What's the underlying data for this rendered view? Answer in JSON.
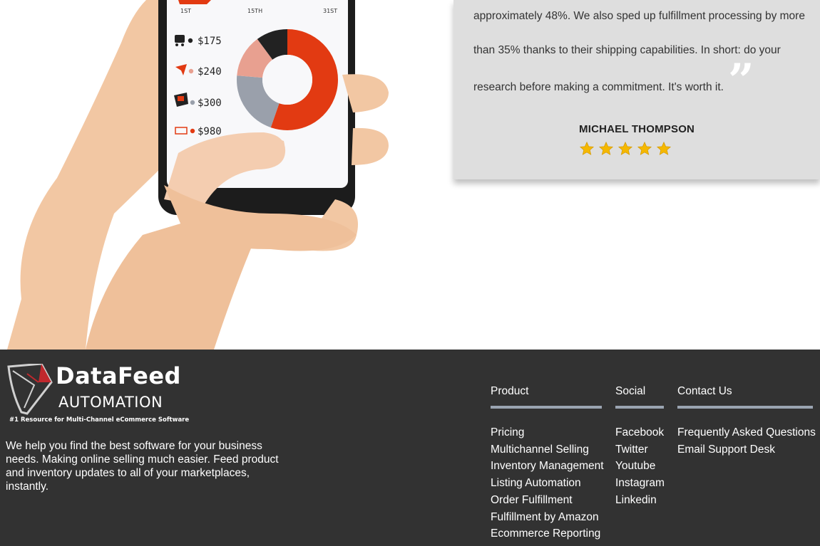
{
  "testimonial": {
    "lines": [
      "approximately 48%. We also sped up fulfillment processing by more",
      "than 35% thanks to their shipping capabilities. In short: do your",
      "research before making a commitment. It's worth it."
    ],
    "quote_mark": "”",
    "author": "MICHAEL THOMPSON",
    "rating": 5
  },
  "phone": {
    "axis_labels": [
      "1ST",
      "15TH",
      "31ST"
    ],
    "amounts": [
      "$175",
      "$240",
      "$300",
      "$980"
    ],
    "icons": [
      "cart-icon",
      "plane-icon",
      "box-icon",
      "cash-icon"
    ],
    "dot_colors": [
      "#222222",
      "#e8a090",
      "#9aa0ab",
      "#e23a12"
    ],
    "donut_colors": [
      "#e23a12",
      "#9aa0ab",
      "#e8a090",
      "#222222"
    ]
  },
  "footer": {
    "logo": {
      "word1": "DataFeed",
      "word2": "AUTOMATION",
      "tagline": "#1 Resource for Multi-Channel eCommerce Software"
    },
    "about": "We help you find the best software for your business needs. Making online selling much easier. Feed product and inventory updates to all of your marketplaces, instantly.",
    "columns": {
      "product": {
        "title": "Product",
        "links": [
          "Pricing",
          "Multichannel Selling",
          "Inventory Management",
          "Listing Automation",
          "Order Fulfillment",
          "Fulfillment by Amazon",
          "Ecommerce Reporting"
        ]
      },
      "social": {
        "title": "Social",
        "links": [
          "Facebook",
          "Twitter",
          "Youtube",
          "Instagram",
          "Linkedin"
        ]
      },
      "contact": {
        "title": "Contact Us",
        "links": [
          "Frequently Asked Questions",
          "Email Support Desk"
        ]
      }
    }
  }
}
